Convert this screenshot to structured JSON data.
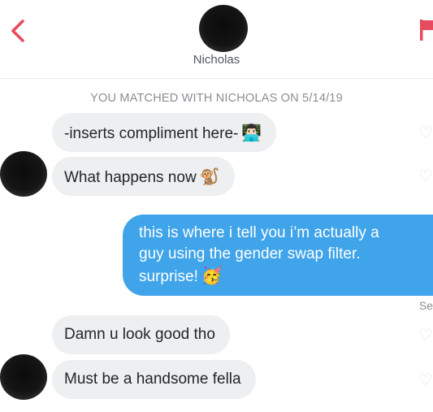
{
  "header": {
    "name": "Nicholas",
    "back_icon": "chevron-left-icon",
    "flag_icon": "flag-icon",
    "accent_color": "#e84b5e"
  },
  "match_banner": "YOU MATCHED WITH NICHOLAS ON 5/14/19",
  "messages": [
    {
      "from": "them",
      "text": "-inserts compliment here-",
      "emoji": "👨🏻‍💻"
    },
    {
      "from": "them",
      "text": "What happens now",
      "emoji": "🐒"
    },
    {
      "from": "me",
      "lines": [
        "this is where i tell you i’m actually a",
        "guy using the gender swap filter.",
        "surprise!"
      ],
      "emoji": "🥳"
    },
    {
      "from": "them",
      "text": "Damn u look good tho"
    },
    {
      "from": "them",
      "text": "Must be a handsome fella"
    }
  ],
  "seen_label": "Se",
  "colors": {
    "sent_bubble": "#3fa4ea",
    "received_bubble": "#eeeff1",
    "banner_text": "#8a8e93"
  }
}
